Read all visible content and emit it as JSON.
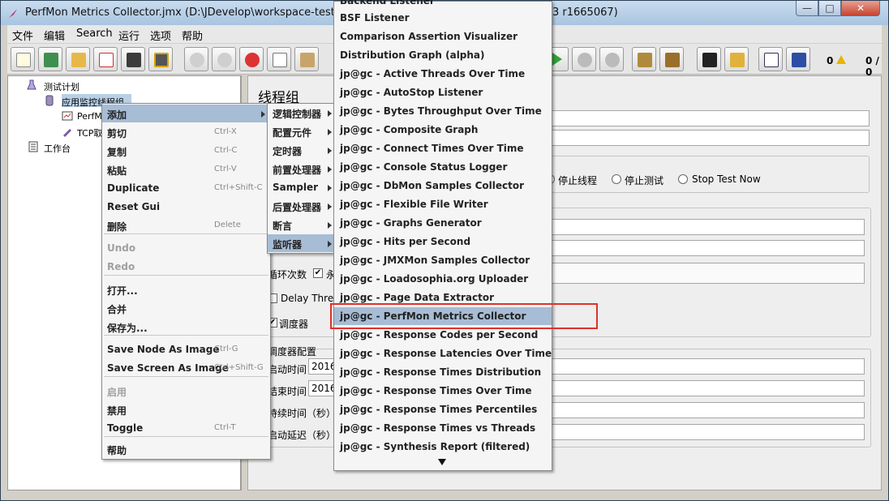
{
  "window": {
    "title": "PerfMon Metrics Collector.jmx (D:\\JDevelop\\workspace-test\\PerfM",
    "title_tail": "3 r1665067)",
    "min_glyph": "—",
    "max_glyph": "□",
    "close_glyph": "✕"
  },
  "menubar": [
    "文件",
    "编辑",
    "Search",
    "运行",
    "选项",
    "帮助"
  ],
  "toolbar": {
    "counter_left": "0",
    "counter_right": "0 / 0",
    "warn_icon": "warning-icon"
  },
  "tree": {
    "root": "测试计划",
    "thread_group": "应用监控线程组",
    "child1": "PerfMo",
    "child2": "TCP取",
    "workbench": "工作台"
  },
  "right": {
    "title": "线程组",
    "radio_options": [
      "停止线程",
      "停止测试",
      "Stop Test Now"
    ],
    "loop_label": "循环次数",
    "forever_label": "永",
    "delay_label": "Delay Threa",
    "scheduler_label": "调度器",
    "scheduler_group": "调度器配置",
    "start_time_label": "启动时间",
    "start_time_value": "2016",
    "end_time_label": "结束时间",
    "end_time_value": "2016",
    "duration_label": "持续时间（秒）",
    "startup_delay_label": "启动延迟（秒）"
  },
  "context_menu": {
    "items": [
      {
        "label": "添加",
        "shortcut": "",
        "arrow": true,
        "selected": true
      },
      {
        "label": "剪切",
        "shortcut": "Ctrl-X"
      },
      {
        "label": "复制",
        "shortcut": "Ctrl-C"
      },
      {
        "label": "粘贴",
        "shortcut": "Ctrl-V"
      },
      {
        "label": "Duplicate",
        "shortcut": "Ctrl+Shift-C"
      },
      {
        "label": "Reset Gui",
        "shortcut": ""
      },
      {
        "label": "删除",
        "shortcut": "Delete"
      },
      {
        "label": "Undo",
        "shortcut": "",
        "disabled": true
      },
      {
        "label": "Redo",
        "shortcut": "",
        "disabled": true
      },
      {
        "label": "打开...",
        "shortcut": ""
      },
      {
        "label": "合并",
        "shortcut": ""
      },
      {
        "label": "保存为...",
        "shortcut": ""
      },
      {
        "label": "Save Node As Image",
        "shortcut": "Ctrl-G"
      },
      {
        "label": "Save Screen As Image",
        "shortcut": "Ctrl+Shift-G"
      },
      {
        "label": "启用",
        "shortcut": "",
        "disabled": true
      },
      {
        "label": "禁用",
        "shortcut": ""
      },
      {
        "label": "Toggle",
        "shortcut": "Ctrl-T"
      },
      {
        "label": "帮助",
        "shortcut": ""
      }
    ]
  },
  "add_submenu": {
    "items": [
      {
        "label": "逻辑控制器"
      },
      {
        "label": "配置元件"
      },
      {
        "label": "定时器"
      },
      {
        "label": "前置处理器"
      },
      {
        "label": "Sampler"
      },
      {
        "label": "后置处理器"
      },
      {
        "label": "断言"
      },
      {
        "label": "监听器",
        "selected": true
      }
    ]
  },
  "listener_submenu": {
    "partial_top": "Backend Listener",
    "items": [
      {
        "label": "BSF Listener"
      },
      {
        "label": "Comparison Assertion Visualizer"
      },
      {
        "label": "Distribution Graph (alpha)"
      },
      {
        "label": "jp@gc - Active Threads Over Time"
      },
      {
        "label": "jp@gc - AutoStop Listener"
      },
      {
        "label": "jp@gc - Bytes Throughput Over Time"
      },
      {
        "label": "jp@gc - Composite Graph"
      },
      {
        "label": "jp@gc - Connect Times Over Time"
      },
      {
        "label": "jp@gc - Console Status Logger"
      },
      {
        "label": "jp@gc - DbMon Samples Collector"
      },
      {
        "label": "jp@gc - Flexible File Writer"
      },
      {
        "label": "jp@gc - Graphs Generator"
      },
      {
        "label": "jp@gc - Hits per Second"
      },
      {
        "label": "jp@gc - JMXMon Samples Collector"
      },
      {
        "label": "jp@gc - Loadosophia.org Uploader"
      },
      {
        "label": "jp@gc - Page Data Extractor"
      },
      {
        "label": "jp@gc - PerfMon Metrics Collector",
        "selected": true
      },
      {
        "label": "jp@gc - Response Codes per Second"
      },
      {
        "label": "jp@gc - Response Latencies Over Time"
      },
      {
        "label": "jp@gc - Response Times Distribution"
      },
      {
        "label": "jp@gc - Response Times Over Time"
      },
      {
        "label": "jp@gc - Response Times Percentiles"
      },
      {
        "label": "jp@gc - Response Times vs Threads"
      },
      {
        "label": "jp@gc - Synthesis Report (filtered)"
      }
    ]
  },
  "colors": {
    "selected_bg": "#a7bcd5",
    "highlight_border": "#e0302c"
  }
}
